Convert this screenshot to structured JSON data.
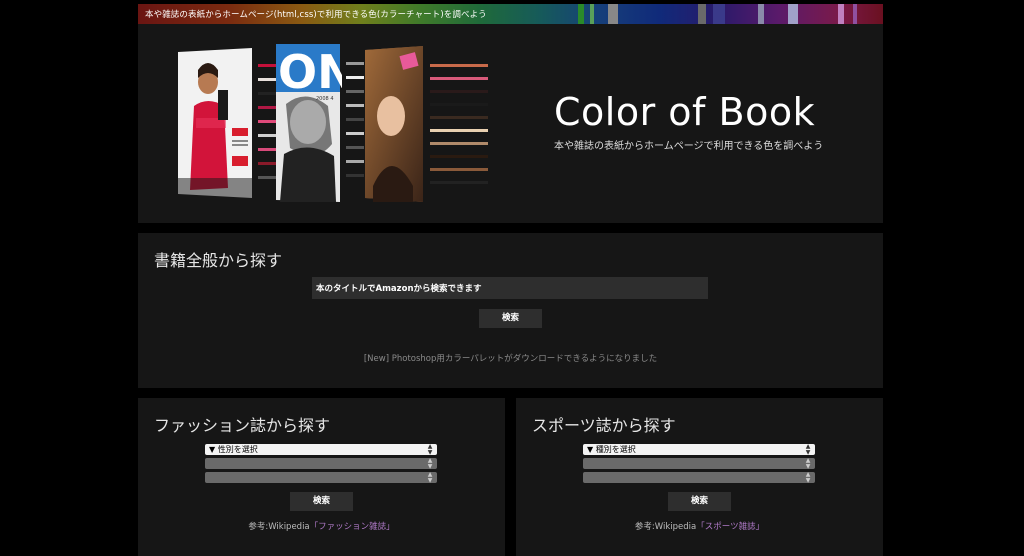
{
  "topbar": {
    "text": "本や雑誌の表紙からホームページ(html,css)で利用できる色(カラーチャート)を調べよう"
  },
  "hero": {
    "title": "Color of Book",
    "subtitle": "本や雑誌の表紙からホームページで利用できる色を調べよう",
    "cover2_text": "ON",
    "cover2_small": "2008 4"
  },
  "search": {
    "heading": "書籍全般から探す",
    "input_value": "本のタイトルでAmazonから検索できます",
    "button_label": "検索",
    "notice": "[New] Photoshop用カラーパレットがダウンロードできるようになりました"
  },
  "fashion": {
    "heading": "ファッション誌から探す",
    "select1": "▼ 性別を選択",
    "select2": "",
    "select3": "",
    "button_label": "検索",
    "ref_prefix": "参考:Wikipedia",
    "ref_link": "「ファッション雑誌」"
  },
  "sports": {
    "heading": "スポーツ誌から探す",
    "select1": "▼ 種別を選択",
    "select2": "",
    "select3": "",
    "button_label": "検索",
    "ref_prefix": "参考:Wikipedia",
    "ref_link": "「スポーツ雑誌」"
  }
}
